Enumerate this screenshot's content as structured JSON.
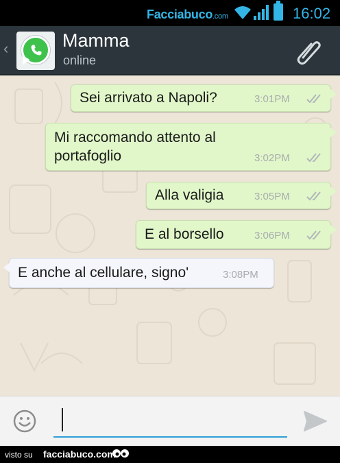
{
  "status_bar": {
    "watermark": "Facciabuco",
    "watermark_suffix": ".com",
    "time": "16:02",
    "accent_color": "#33b5e5"
  },
  "header": {
    "back_icon": "chevron-left-icon",
    "contact_name": "Mamma",
    "contact_status": "online",
    "attach_icon": "paperclip-icon"
  },
  "messages": [
    {
      "direction": "outgoing",
      "lines": [
        "Sei arrivato a Napoli?"
      ],
      "time": "3:01PM",
      "read": true
    },
    {
      "direction": "outgoing",
      "lines": [
        "Mi raccomando attento al",
        "portafoglio"
      ],
      "time": "3:02PM",
      "read": true
    },
    {
      "direction": "outgoing",
      "lines": [
        "Alla valigia"
      ],
      "time": "3:05PM",
      "read": true
    },
    {
      "direction": "outgoing",
      "lines": [
        "E al borsello"
      ],
      "time": "3:06PM",
      "read": true
    },
    {
      "direction": "incoming",
      "lines": [
        "E anche al cellulare, signo'"
      ],
      "time": "3:08PM"
    }
  ],
  "input_bar": {
    "emoji_icon": "smiley-icon",
    "message_value": "",
    "send_icon": "send-arrow-icon"
  },
  "footer": {
    "visto": "visto su",
    "site": "facciabuco.com"
  },
  "colors": {
    "header_bg": "#2b353b",
    "outgoing_bubble": "#e1f7c9",
    "incoming_bubble": "#f5f6fb",
    "chat_bg": "#ece5d8",
    "input_underline": "#2d9fd8"
  }
}
